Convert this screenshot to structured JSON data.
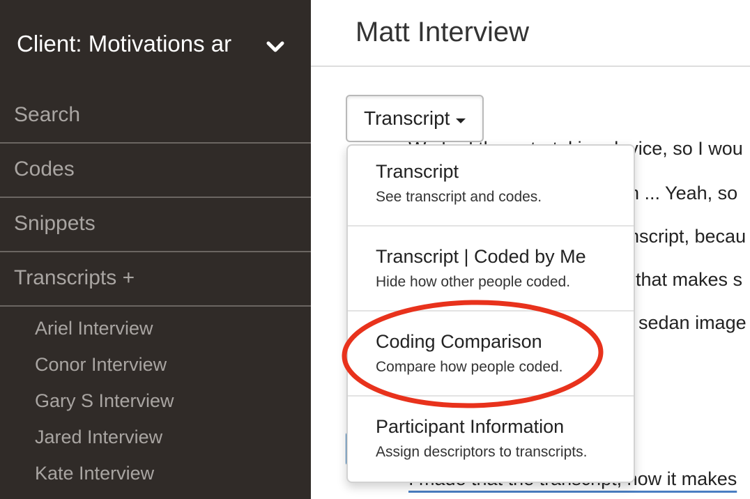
{
  "sidebar": {
    "project_title": "Client: Motivations ar",
    "nav": {
      "search": "Search",
      "codes": "Codes",
      "snippets": "Snippets",
      "transcripts": "Transcripts +"
    },
    "transcripts": [
      "Ariel Interview",
      "Conor Interview",
      "Gary S Interview",
      "Jared Interview",
      "Kate Interview"
    ]
  },
  "main": {
    "title": "Matt Interview",
    "view_button_label": "Transcript",
    "background_lines": [
      "We had the note-taking device, so I wou",
      "h ... Yeah, so",
      "nscript, becau",
      "that makes s",
      "sedan image",
      "I made that the transcript, how it makes"
    ]
  },
  "dropdown": {
    "items": [
      {
        "title": "Transcript",
        "description": "See transcript and codes."
      },
      {
        "title": "Transcript | Coded by Me",
        "description": "Hide how other people coded."
      },
      {
        "title": "Coding Comparison",
        "description": "Compare how people coded."
      },
      {
        "title": "Participant Information",
        "description": "Assign descriptors to transcripts."
      }
    ]
  },
  "colors": {
    "sidebar_bg": "#302b28",
    "annotation": "#e8321c",
    "link_underline": "#4a7ec2"
  }
}
